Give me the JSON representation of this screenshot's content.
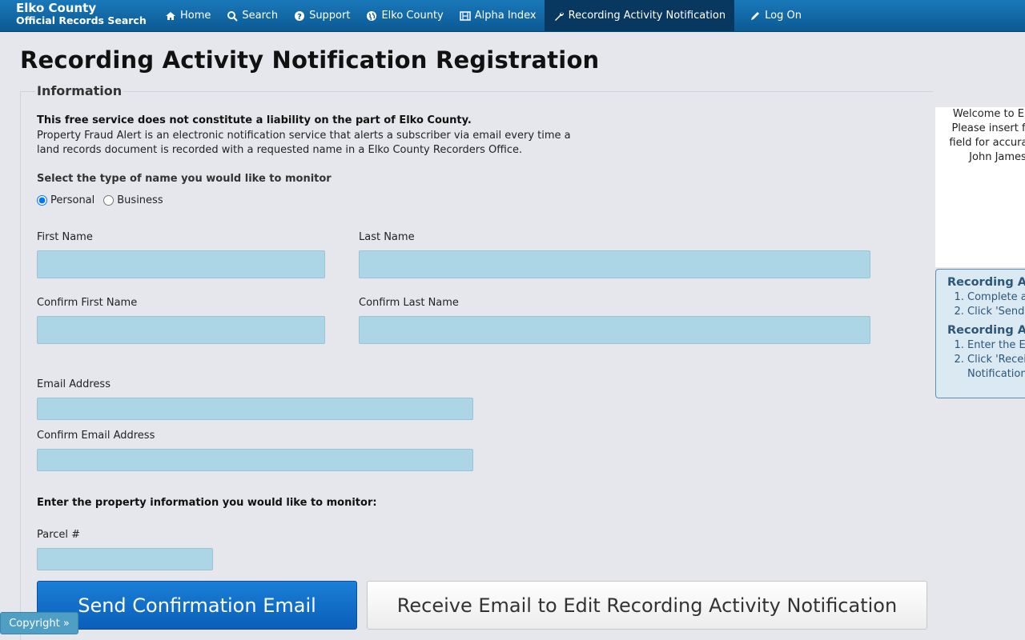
{
  "brand": {
    "line1": "Elko County",
    "line2": "Official Records Search"
  },
  "nav": [
    {
      "label": "Home",
      "icon": "home-icon"
    },
    {
      "label": "Search",
      "icon": "search-icon"
    },
    {
      "label": "Support",
      "icon": "question-icon"
    },
    {
      "label": "Elko County",
      "icon": "globe-icon"
    },
    {
      "label": "Alpha Index",
      "icon": "film-icon"
    },
    {
      "label": "Recording Activity Notification",
      "icon": "wrench-icon",
      "active": true
    },
    {
      "label": "Log On",
      "icon": "pencil-icon"
    }
  ],
  "page": {
    "title": "Recording Activity Notification Registration"
  },
  "info": {
    "legend": "Information",
    "disclaimer": "This free service does not constitute a liability on the part of Elko County.",
    "description": "Property Fraud Alert is an electronic notification service that alerts a subscriber via email every time a land records document is recorded with a requested name in a Elko County Recorders Office."
  },
  "name_type": {
    "label": "Select the type of name you would like to monitor",
    "options": [
      "Personal",
      "Business"
    ],
    "selected": "Personal"
  },
  "fields": {
    "first_name": "First Name",
    "last_name": "Last Name",
    "confirm_first_name": "Confirm First Name",
    "confirm_last_name": "Confirm Last Name",
    "email": "Email Address",
    "confirm_email": "Confirm Email Address",
    "property_label": "Enter the property information you would like to monitor:",
    "parcel": "Parcel #"
  },
  "buttons": {
    "send": "Send Confirmation Email",
    "edit": "Receive Email to Edit Recording Activity Notification"
  },
  "welcome_panel": {
    "lines": [
      "Welcome to Elk",
      "Please insert fir",
      "field for accurac",
      "John James"
    ]
  },
  "help_panel": {
    "section1_title": "Recording A",
    "section1_items": [
      "Complete a",
      "Click 'Send"
    ],
    "section2_title": "Recording A",
    "section2_items": [
      "Enter the E",
      "Click 'Recei"
    ],
    "section2_item2_cont": "Notification"
  },
  "footer": {
    "copyright": "Copyright »"
  },
  "colors": {
    "nav_bg": "#0b5a93",
    "input_bg": "#acd5e6",
    "primary_btn": "#0a5fbb"
  }
}
